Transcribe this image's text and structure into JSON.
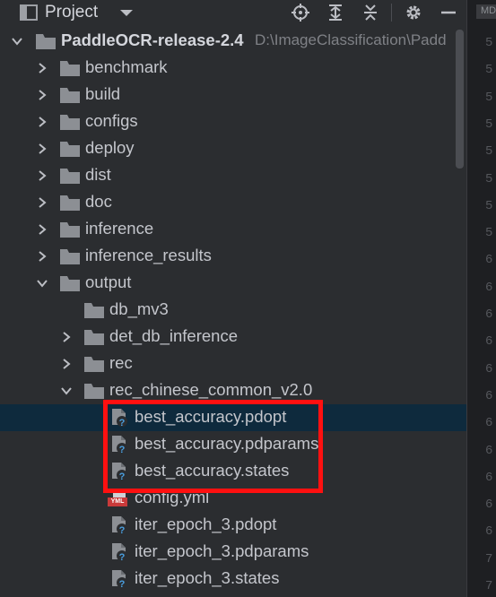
{
  "toolbar": {
    "title": "Project",
    "icons": [
      "project-view-icon",
      "dropdown-icon",
      "locate-icon",
      "expand-all-icon",
      "collapse-all-icon",
      "settings-icon",
      "hide-icon"
    ]
  },
  "root": {
    "name": "PaddleOCR-release-2.4",
    "path": "D:\\ImageClassification\\Padd"
  },
  "tree": [
    {
      "label": "benchmark",
      "type": "folder",
      "depth": 1,
      "expanded": false
    },
    {
      "label": "build",
      "type": "folder",
      "depth": 1,
      "expanded": false
    },
    {
      "label": "configs",
      "type": "folder",
      "depth": 1,
      "expanded": false
    },
    {
      "label": "deploy",
      "type": "folder",
      "depth": 1,
      "expanded": false
    },
    {
      "label": "dist",
      "type": "folder",
      "depth": 1,
      "expanded": false
    },
    {
      "label": "doc",
      "type": "folder",
      "depth": 1,
      "expanded": false
    },
    {
      "label": "inference",
      "type": "folder",
      "depth": 1,
      "expanded": false
    },
    {
      "label": "inference_results",
      "type": "folder",
      "depth": 1,
      "expanded": false
    },
    {
      "label": "output",
      "type": "folder",
      "depth": 1,
      "expanded": true
    },
    {
      "label": "db_mv3",
      "type": "folder",
      "depth": 2,
      "expanded": null
    },
    {
      "label": "det_db_inference",
      "type": "folder",
      "depth": 2,
      "expanded": false
    },
    {
      "label": "rec",
      "type": "folder",
      "depth": 2,
      "expanded": false
    },
    {
      "label": "rec_chinese_common_v2.0",
      "type": "folder",
      "depth": 2,
      "expanded": true
    },
    {
      "label": "best_accuracy.pdopt",
      "type": "unknown-file",
      "depth": 3,
      "selected": true
    },
    {
      "label": "best_accuracy.pdparams",
      "type": "unknown-file",
      "depth": 3
    },
    {
      "label": "best_accuracy.states",
      "type": "unknown-file",
      "depth": 3
    },
    {
      "label": "config.yml",
      "type": "yml-file",
      "depth": 3
    },
    {
      "label": "iter_epoch_3.pdopt",
      "type": "unknown-file",
      "depth": 3
    },
    {
      "label": "iter_epoch_3.pdparams",
      "type": "unknown-file",
      "depth": 3
    },
    {
      "label": "iter_epoch_3.states",
      "type": "unknown-file",
      "depth": 3
    }
  ],
  "yml_badge": "YML",
  "gutter_tab": "MD",
  "line_numbers": [
    "5",
    "5",
    "5",
    "5",
    "5",
    "5",
    "5",
    "5",
    "6",
    "6",
    "6",
    "6",
    "6",
    "6",
    "6",
    "6",
    "6",
    "6",
    "6",
    "7",
    "7"
  ],
  "colors": {
    "selection": "#0e2a3d",
    "highlight": "#ff1010",
    "folder": "#8c8f94",
    "background": "#2b2d30"
  }
}
